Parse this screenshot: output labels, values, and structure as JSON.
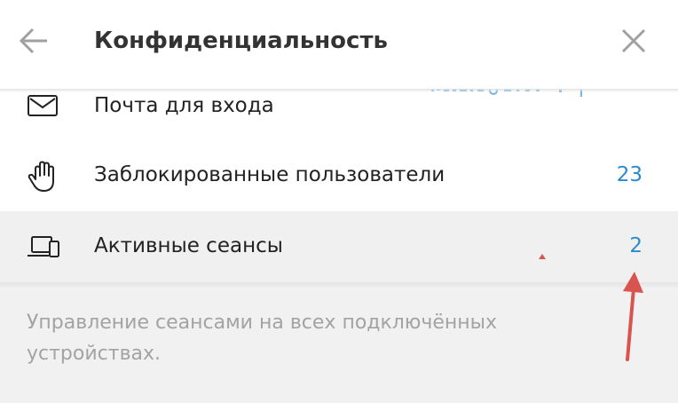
{
  "header": {
    "title": "Конфиденциальность",
    "back_icon": "arrow-left-icon",
    "close_icon": "close-icon"
  },
  "list": {
    "items": [
      {
        "label": "Почта для входа",
        "value": "",
        "icon": "envelope-icon"
      },
      {
        "label": "Заблокированные пользователи",
        "value": "23",
        "icon": "raised-hand-icon"
      },
      {
        "label": "Активные сеансы",
        "value": "2",
        "icon": "devices-icon"
      }
    ]
  },
  "footer": {
    "note": "Управление сеансами на всех подключённых устройствах."
  },
  "colors": {
    "accent": "#2a8ccc",
    "annotation_arrow": "#d9534f",
    "muted_text": "#a3a3a3",
    "title_text": "#333333"
  }
}
